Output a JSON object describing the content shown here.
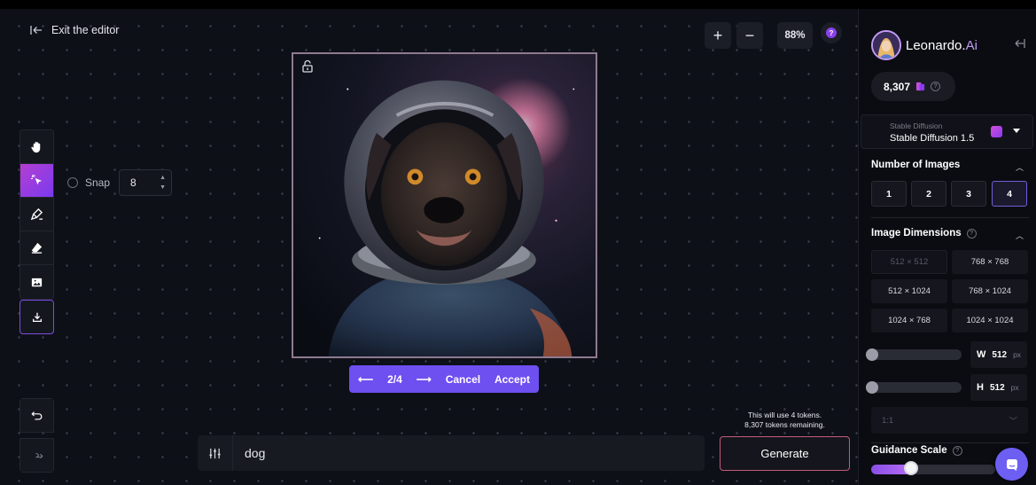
{
  "editor": {
    "exit_label": "Exit the editor",
    "zoom_in": "+",
    "zoom_out": "−",
    "zoom_level": "88%",
    "help": "?"
  },
  "tools": [
    "hand-tool",
    "select-tool",
    "brush-tool",
    "eraser-tool",
    "image-tool",
    "download"
  ],
  "snap": {
    "label": "Snap",
    "value": "8"
  },
  "candidates": {
    "position": "2/4",
    "cancel_label": "Cancel",
    "accept_label": "Accept"
  },
  "prompt": {
    "value": "dog"
  },
  "generate": {
    "note_line1": "This will use 4 tokens.",
    "note_line2": "8,307 tokens remaining.",
    "label": "Generate"
  },
  "sidebar": {
    "brand_name": "Leonardo.",
    "brand_suffix": "Ai",
    "token_count": "8,307",
    "model": {
      "category": "Stable Diffusion",
      "name": "Stable Diffusion 1.5"
    },
    "number_of_images": {
      "title": "Number of Images",
      "options": [
        "1",
        "2",
        "3",
        "4"
      ],
      "selected": "4"
    },
    "image_dimensions": {
      "title": "Image Dimensions",
      "options": [
        "512 × 512",
        "768 × 768",
        "512 × 1024",
        "768 × 1024",
        "1024 × 768",
        "1024 × 1024"
      ],
      "disabled": "512 × 512"
    },
    "width": {
      "label": "W",
      "value": "512",
      "unit": "px"
    },
    "height": {
      "label": "H",
      "value": "512",
      "unit": "px"
    },
    "aspect_ratio": "1:1",
    "guidance": {
      "title": "Guidance Scale",
      "level": 0.32
    }
  },
  "colors": {
    "accent": "#6e4ff0",
    "canvas_bg": "#0e1018",
    "panel_bg": "#0b0c12"
  }
}
